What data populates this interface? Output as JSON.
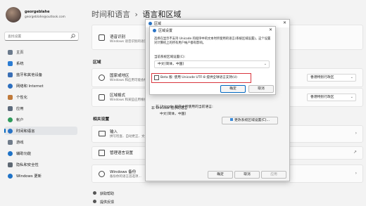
{
  "user": {
    "name": "georgeblahe",
    "email": "georgeblahe@outlook.com"
  },
  "sidebar": {
    "search_placeholder": "查找设置",
    "items": [
      {
        "label": "主页"
      },
      {
        "label": "系统"
      },
      {
        "label": "蓝牙和其他设备"
      },
      {
        "label": "网络和 Internet"
      },
      {
        "label": "个性化"
      },
      {
        "label": "应用"
      },
      {
        "label": "帐户"
      },
      {
        "label": "时间和语言"
      },
      {
        "label": "游戏"
      },
      {
        "label": "辅助功能"
      },
      {
        "label": "隐私和安全性"
      },
      {
        "label": "Windows 更新"
      }
    ]
  },
  "header": {
    "breadcrumb_parent": "时间和语言",
    "separator": "›",
    "breadcrumb_current": "语言和区域"
  },
  "main": {
    "speech_card": {
      "title": "语音识别",
      "subtitle": "Windows 语音识别的语音..."
    },
    "region_section": "区域",
    "country_card": {
      "title": "国家或地区",
      "subtitle": "Windows 和应用可能会根据你所在的地区...",
      "value": "香港特别行政区"
    },
    "format_card": {
      "title": "区域格式",
      "subtitle": "Windows 和某些应用根据区域格式设置日期和时间格式",
      "value": "香港特别行政区"
    },
    "related_section": "相关设置",
    "typing_card": {
      "title": "输入",
      "subtitle": "拼写检查、自动更正、文本建议"
    },
    "admin_lang_card": {
      "title": "管理语言设置"
    },
    "backup_card": {
      "title": "Windows 备份",
      "subtitle": "备份你的语言首选项..."
    },
    "links": [
      "获取帮助",
      "提供反馈"
    ]
  },
  "region_dialog": {
    "title": "区域",
    "unicode_section": "非 Unicode 程序的语言",
    "unicode_desc": "非 Unicode 程序中所使用的当前语言:",
    "current_lang": "中文(简体，中国)",
    "change_button": "更改系统区域设置(C)...",
    "ok": "确定",
    "cancel": "取消",
    "apply": "应用"
  },
  "locale_dialog": {
    "title": "区域设置",
    "description": "选择在显示不支持 Unicode 的程序中的文本时所使用的语言(系统区域设置)。这个设置对计算机上的所有用户帐户都有影响。",
    "label": "当前系统区域设置(C):",
    "selected_value": "中文(简体，中国)",
    "beta_checkbox_label": "Beta 版: 使用 Unicode UTF-8 提供全球语言支持(U)",
    "beta_checked": false,
    "ok": "确定",
    "cancel": "取消"
  },
  "colors": {
    "accent": "#0067c0",
    "highlight_box": "#d9363e"
  }
}
